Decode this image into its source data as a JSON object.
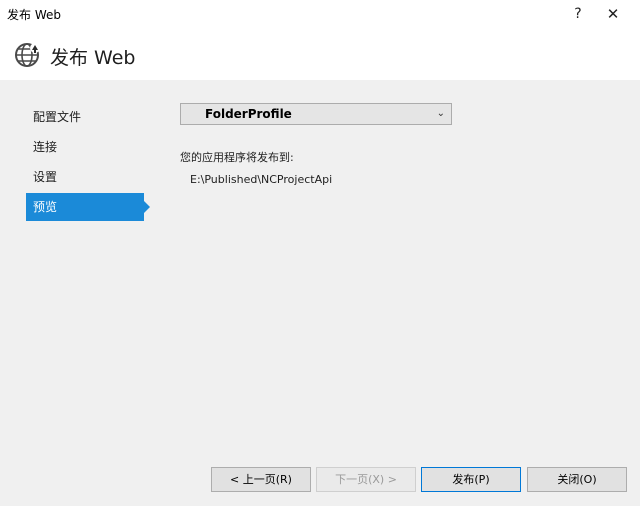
{
  "window": {
    "title": "发布 Web",
    "help_label": "?",
    "close_label": "✕"
  },
  "header": {
    "title": "发布 Web",
    "icon": "globe-icon"
  },
  "nav": {
    "items": [
      {
        "label": "配置文件",
        "active": false
      },
      {
        "label": "连接",
        "active": false
      },
      {
        "label": "设置",
        "active": false
      },
      {
        "label": "预览",
        "active": true
      }
    ]
  },
  "main": {
    "profile_selected": "FolderProfile",
    "publish_to_label": "您的应用程序将发布到:",
    "publish_path": "E:\\Published\\NCProjectApi"
  },
  "buttons": {
    "prev": "< 上一页(R)",
    "next": "下一页(X) >",
    "publish": "发布(P)",
    "close": "关闭(O)"
  },
  "colors": {
    "accent": "#1b8ad8",
    "background": "#f0f0f0"
  }
}
